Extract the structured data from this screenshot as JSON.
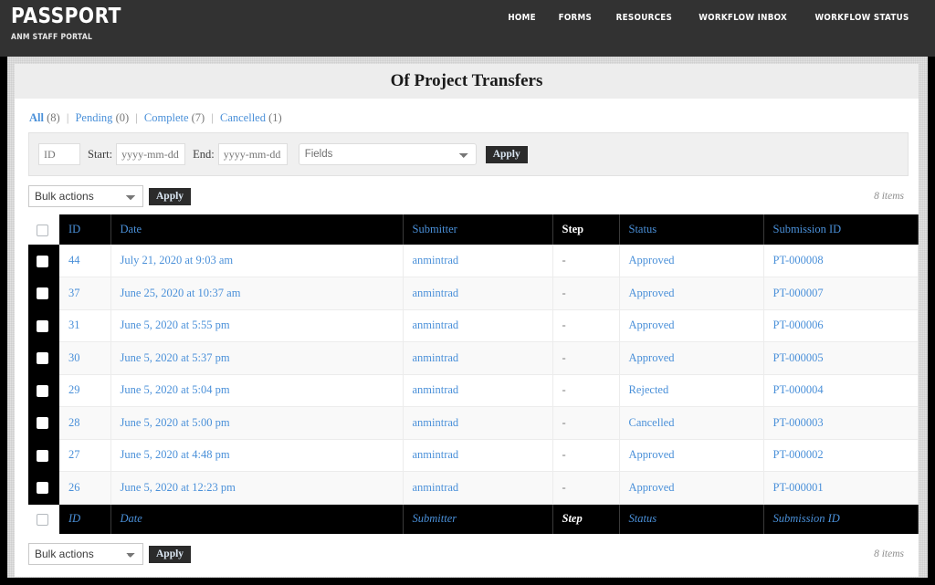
{
  "header": {
    "brand_title": "PASSPORT",
    "brand_subtitle": "ANM STAFF PORTAL",
    "nav": [
      {
        "label": "HOME",
        "name": "nav-home"
      },
      {
        "label": "FORMS",
        "name": "nav-forms"
      },
      {
        "label": "RESOURCES",
        "name": "nav-resources"
      },
      {
        "label": "WORKFLOW INBOX",
        "name": "nav-workflow-inbox"
      },
      {
        "label": "WORKFLOW STATUS",
        "name": "nav-workflow-status"
      }
    ]
  },
  "page": {
    "title": "Of Project Transfers"
  },
  "status_filters": [
    {
      "label": "All",
      "count": "(8)",
      "current": true
    },
    {
      "label": "Pending",
      "count": "(0)",
      "current": false
    },
    {
      "label": "Complete",
      "count": "(7)",
      "current": false
    },
    {
      "label": "Cancelled",
      "count": "(1)",
      "current": false
    }
  ],
  "filter_bar": {
    "id_placeholder": "ID",
    "id_value": "",
    "start_label": "Start:",
    "start_placeholder": "yyyy-mm-dd",
    "start_value": "",
    "end_label": "End:",
    "end_placeholder": "yyyy-mm-dd",
    "end_value": "",
    "fields_selected": "Fields",
    "apply_label": "Apply"
  },
  "tablenav_top": {
    "bulk_selected": "Bulk actions",
    "apply_label": "Apply",
    "item_count": "8 items"
  },
  "tablenav_bottom": {
    "bulk_selected": "Bulk actions",
    "apply_label": "Apply",
    "item_count": "8 items"
  },
  "table": {
    "columns": [
      {
        "key": "id",
        "label": "ID",
        "sortable": true
      },
      {
        "key": "date",
        "label": "Date",
        "sortable": true
      },
      {
        "key": "submitter",
        "label": "Submitter",
        "sortable": true
      },
      {
        "key": "step",
        "label": "Step",
        "sortable": false
      },
      {
        "key": "status",
        "label": "Status",
        "sortable": true
      },
      {
        "key": "submission_id",
        "label": "Submission ID",
        "sortable": true
      }
    ],
    "rows": [
      {
        "id": "44",
        "date": "July 21, 2020 at 9:03 am",
        "submitter": "anmintrad",
        "step": "-",
        "status": "Approved",
        "submission_id": "PT-000008"
      },
      {
        "id": "37",
        "date": "June 25, 2020 at 10:37 am",
        "submitter": "anmintrad",
        "step": "-",
        "status": "Approved",
        "submission_id": "PT-000007"
      },
      {
        "id": "31",
        "date": "June 5, 2020 at 5:55 pm",
        "submitter": "anmintrad",
        "step": "-",
        "status": "Approved",
        "submission_id": "PT-000006"
      },
      {
        "id": "30",
        "date": "June 5, 2020 at 5:37 pm",
        "submitter": "anmintrad",
        "step": "-",
        "status": "Approved",
        "submission_id": "PT-000005"
      },
      {
        "id": "29",
        "date": "June 5, 2020 at 5:04 pm",
        "submitter": "anmintrad",
        "step": "-",
        "status": "Rejected",
        "submission_id": "PT-000004"
      },
      {
        "id": "28",
        "date": "June 5, 2020 at 5:00 pm",
        "submitter": "anmintrad",
        "step": "-",
        "status": "Cancelled",
        "submission_id": "PT-000003"
      },
      {
        "id": "27",
        "date": "June 5, 2020 at 4:48 pm",
        "submitter": "anmintrad",
        "step": "-",
        "status": "Approved",
        "submission_id": "PT-000002"
      },
      {
        "id": "26",
        "date": "June 5, 2020 at 12:23 pm",
        "submitter": "anmintrad",
        "step": "-",
        "status": "Approved",
        "submission_id": "PT-000001"
      }
    ]
  },
  "colors": {
    "link": "#4a90d9",
    "topbar": "#323232",
    "table_header_bg": "#000000",
    "button_bg": "#2b2b2b"
  }
}
